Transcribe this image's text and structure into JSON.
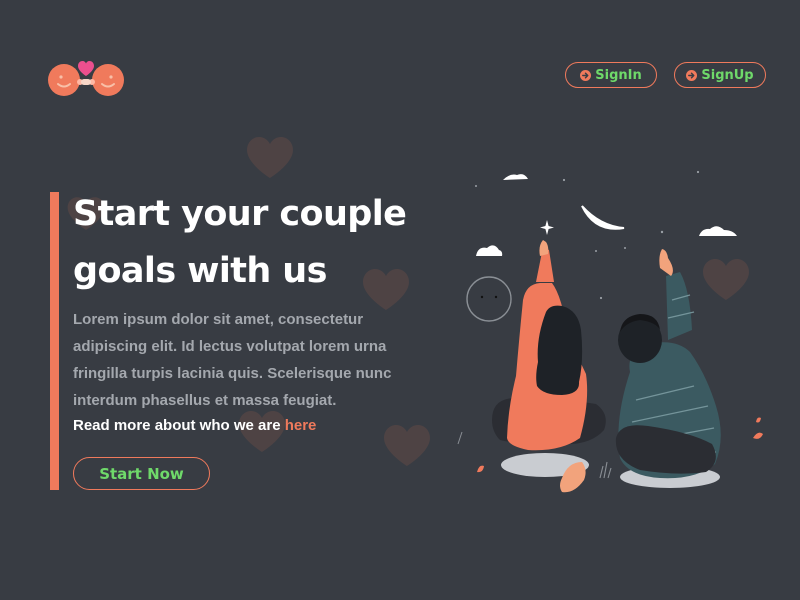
{
  "nav": {
    "signin_label": "SignIn",
    "signup_label": "SignUp"
  },
  "hero": {
    "title": "Start your couple goals with us",
    "description": "Lorem ipsum dolor sit amet, consectetur adipiscing elit. Id lectus volutpat lorem urna fringilla turpis lacinia quis. Scelerisque nunc interdum phasellus et massa feugiat.",
    "read_more_text": "Read more about who we are",
    "read_more_link": "here",
    "cta_label": "Start Now"
  },
  "icons": {
    "logo": "couple-faces-heart-logo",
    "nav_button": "arrow-circle-right-icon",
    "background": "heart-icon"
  },
  "colors": {
    "background": "#383c43",
    "accent": "#f07a5c",
    "button_text": "#6fd96a",
    "body_text": "#a4a8ae",
    "heading": "#ffffff",
    "heart_fill": "#4e4344"
  }
}
